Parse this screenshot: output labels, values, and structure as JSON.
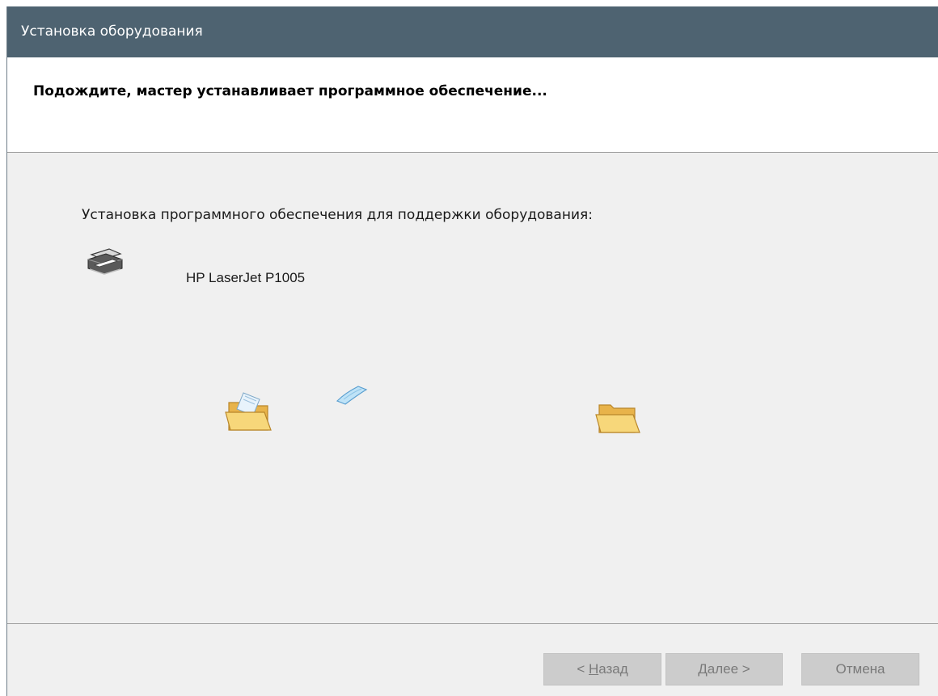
{
  "window": {
    "title": "Установка оборудования"
  },
  "header": {
    "title": "Подождите, мастер устанавливает программное обеспечение..."
  },
  "content": {
    "intro": "Установка программного обеспечения для поддержки оборудования:",
    "device_name": "HP LaserJet P1005",
    "device_icon": "printer-icon",
    "animation": {
      "source_icon": "folder-open-icon",
      "moving_icon": "paper-icon",
      "destination_icon": "folder-open-icon"
    }
  },
  "buttons": {
    "back": {
      "prefix": "< ",
      "hotkey": "Н",
      "rest": "азад"
    },
    "next": {
      "hotkey": "Д",
      "rest": "алее >"
    },
    "cancel": "Отмена"
  },
  "colors": {
    "titlebar": "#4e6371",
    "panel": "#f0f0f0",
    "button_disabled": "#cccccc",
    "folder": "#f2c35a"
  }
}
